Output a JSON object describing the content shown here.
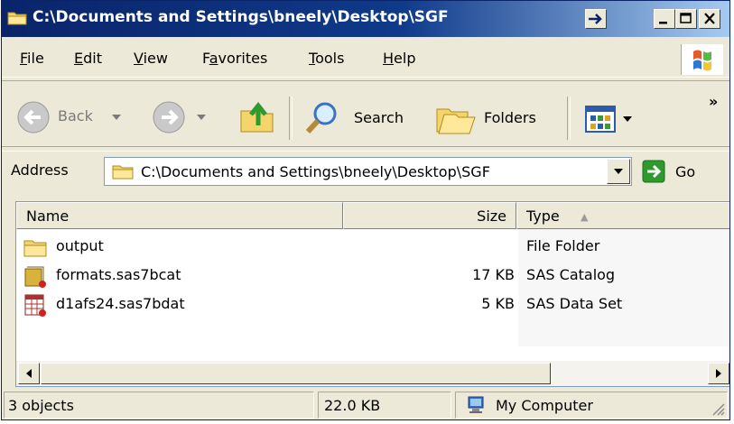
{
  "window": {
    "title": "C:\\Documents and Settings\\bneely\\Desktop\\SGF"
  },
  "menu": {
    "items": [
      {
        "label": "File",
        "mnemonic": "F"
      },
      {
        "label": "Edit",
        "mnemonic": "E"
      },
      {
        "label": "View",
        "mnemonic": "V"
      },
      {
        "label": "Favorites",
        "mnemonic": "a"
      },
      {
        "label": "Tools",
        "mnemonic": "T"
      },
      {
        "label": "Help",
        "mnemonic": "H"
      }
    ]
  },
  "toolbar": {
    "back_label": "Back",
    "search_label": "Search",
    "folders_label": "Folders",
    "chevron": "»"
  },
  "address": {
    "label": "Address",
    "value": "C:\\Documents and Settings\\bneely\\Desktop\\SGF",
    "go_label": "Go"
  },
  "list": {
    "columns": {
      "name": "Name",
      "size": "Size",
      "type": "Type"
    },
    "sort_indicator": "▲",
    "rows": [
      {
        "name": "output",
        "size": "",
        "type": "File Folder",
        "icon": "folder-icon"
      },
      {
        "name": "formats.sas7bcat",
        "size": "17 KB",
        "type": "SAS Catalog",
        "icon": "sas-catalog-icon"
      },
      {
        "name": "d1afs24.sas7bdat",
        "size": "5 KB",
        "type": "SAS Data Set",
        "icon": "sas-dataset-icon"
      }
    ]
  },
  "status": {
    "objects": "3 objects",
    "size": "22.0 KB",
    "zone": "My Computer"
  },
  "colors": {
    "title_start": "#0a246a",
    "title_end": "#a6caf0",
    "chrome": "#ece9d8",
    "go_green": "#2e9a2e"
  }
}
